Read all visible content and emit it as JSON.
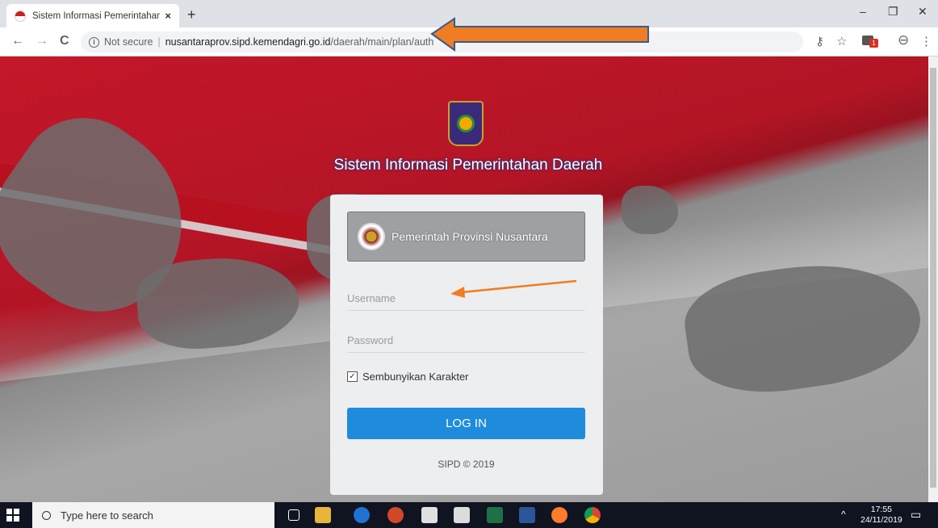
{
  "browser": {
    "tab_title": "Sistem Informasi Pemerintahan D",
    "tab_close": "×",
    "new_tab": "+",
    "url_security": "Not secure",
    "url_separator": "|",
    "url_host": "nusantaraprov.sipd.kemendagri.go.id",
    "url_path": "/daerah/main/plan/auth",
    "back": "←",
    "forward": "→",
    "reload": "C",
    "info": "i",
    "minimize": "–",
    "restore": "❐",
    "close": "✕",
    "key": "⚷",
    "star": "☆",
    "ext_badge": "1",
    "profile": "⊖",
    "menu": "⋮"
  },
  "page": {
    "app_title": "Sistem Informasi Pemerintahan Daerah",
    "gov_name": "Pemerintah Provinsi Nusantara",
    "username_placeholder": "Username",
    "password_placeholder": "Password",
    "hide_chars_check": "✓",
    "hide_chars_label": "Sembunyikan Karakter",
    "login_label": "LOG IN",
    "footer": "SIPD © 2019"
  },
  "taskbar": {
    "search_placeholder": "Type here to search",
    "time": "17:55",
    "date": "24/11/2019",
    "tray_up": "^",
    "notifications": "▭"
  },
  "colors": {
    "login_blue": "#1f8bdc",
    "page_red": "#c4172a",
    "annotation_arrow": "#f07d22"
  }
}
